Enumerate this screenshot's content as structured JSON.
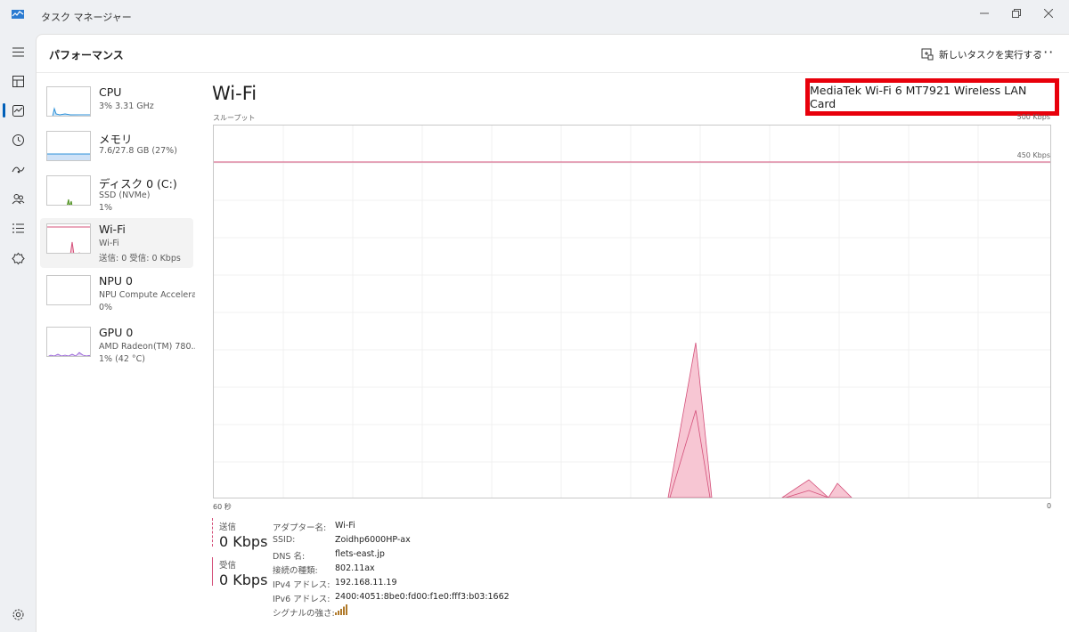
{
  "window": {
    "title": "タスク マネージャー"
  },
  "header": {
    "page_title": "パフォーマンス",
    "run_new_task": "新しいタスクを実行する",
    "more": "···"
  },
  "sidebar": {
    "items": [
      {
        "name": "CPU",
        "line1": "3%  3.31 GHz",
        "line2": ""
      },
      {
        "name": "メモリ",
        "line1": "7.6/27.8 GB (27%)",
        "line2": ""
      },
      {
        "name": "ディスク 0 (C:)",
        "line1": "SSD (NVMe)",
        "line2": "1%"
      },
      {
        "name": "Wi-Fi",
        "line1": "Wi-Fi",
        "line2": "送信: 0 受信: 0 Kbps"
      },
      {
        "name": "NPU 0",
        "line1": "NPU Compute Accelera...",
        "line2": "0%"
      },
      {
        "name": "GPU 0",
        "line1": "AMD Radeon(TM) 780...",
        "line2": "1% (42 °C)"
      }
    ]
  },
  "detail": {
    "title": "Wi-Fi",
    "adapter": "MediaTek Wi-Fi 6 MT7921 Wireless LAN Card",
    "throughput_label": "スループット",
    "max_label": "500 Kbps",
    "line_label": "450 Kbps",
    "time_label": "60 秒",
    "zero_label": "0",
    "send_label": "送信",
    "send_value": "0 Kbps",
    "recv_label": "受信",
    "recv_value": "0 Kbps",
    "properties": [
      {
        "key": "アダプター名:",
        "value": "Wi-Fi"
      },
      {
        "key": "SSID:",
        "value": "Zoidhp6000HP-ax"
      },
      {
        "key": "DNS 名:",
        "value": "flets-east.jp"
      },
      {
        "key": "接続の種類:",
        "value": "802.11ax"
      },
      {
        "key": "IPv4 アドレス:",
        "value": "192.168.11.19"
      },
      {
        "key": "IPv6 アドレス:",
        "value": "2400:4051:8be0:fd00:f1e0:fff3:b03:1662"
      },
      {
        "key": "シグナルの強さ:",
        "value": ""
      }
    ]
  },
  "colors": {
    "accent": "#005fb8",
    "network": "#d4507a",
    "network_fill": "#f7c6d3",
    "highlight": "#e8000b",
    "cpu": "#2c90d9",
    "disk": "#4d8f1f",
    "gpu": "#8a4fd1"
  },
  "icons": [
    "menu-icon",
    "processes-icon",
    "performance-icon",
    "app-history-icon",
    "startup-icon",
    "users-icon",
    "details-icon",
    "services-icon",
    "settings-icon"
  ]
}
